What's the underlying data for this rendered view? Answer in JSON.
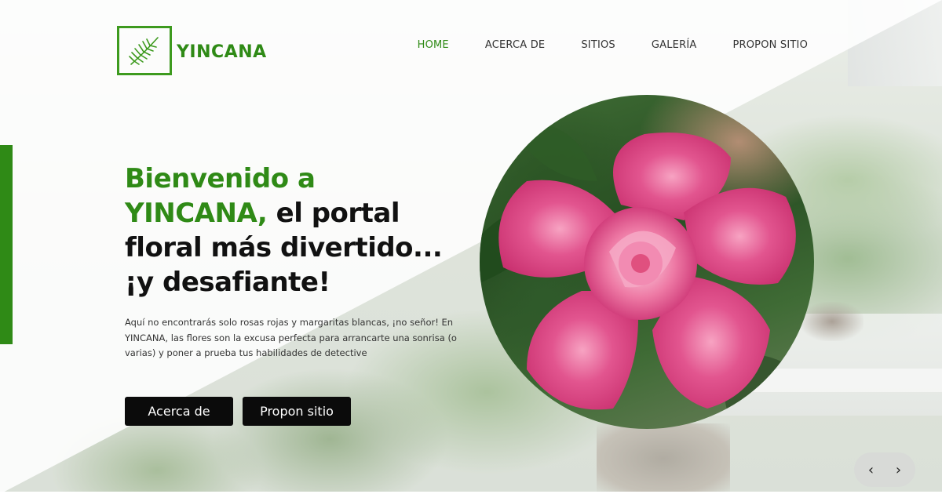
{
  "brand": {
    "name": "YINCANA",
    "logo_icon": "palm-leaf-icon",
    "color": "#2f8a16"
  },
  "nav": {
    "items": [
      {
        "label": "HOME",
        "active": true
      },
      {
        "label": "ACERCA DE",
        "active": false
      },
      {
        "label": "SITIOS",
        "active": false
      },
      {
        "label": "GALERÍA",
        "active": false
      },
      {
        "label": "PROPON SITIO",
        "active": false
      }
    ]
  },
  "hero": {
    "title_green_1": "Bienvenido a",
    "title_green_2": "YINCANA,",
    "title_black_1": " el portal",
    "title_black_2": "floral más divertido...",
    "title_black_3": "¡y desafiante!",
    "description": "Aquí no encontrarás solo rosas rojas y margaritas blancas, ¡no señor! En YINCANA, las flores son la excusa perfecta para arrancarte una sonrisa (o varias) y poner a prueba tus habilidades de detective",
    "buttons": {
      "about": "Acerca de",
      "propose": "Propon sitio"
    }
  },
  "slider": {
    "prev_icon": "‹",
    "next_icon": "›"
  },
  "colors": {
    "accent": "#2f8a16",
    "button_bg": "#0b0b0b",
    "flower": "#e2558f"
  }
}
